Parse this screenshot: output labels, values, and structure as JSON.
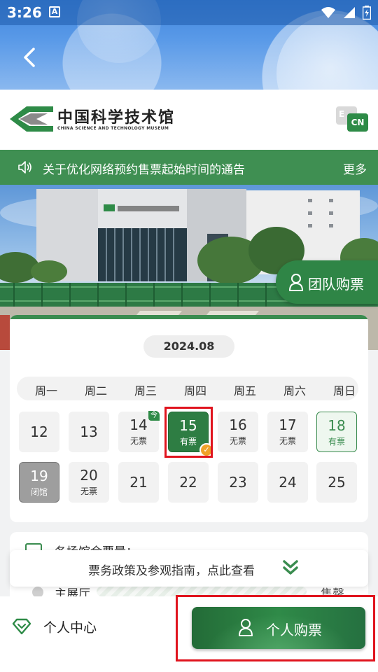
{
  "status_bar": {
    "time": "3:26",
    "notification_glyph": "A"
  },
  "header": {
    "logo_title": "中国科学技术馆",
    "logo_subtitle": "CHINA SCIENCE AND TECHNOLOGY MUSEUM",
    "lang_en": "E",
    "lang_cn": "CN"
  },
  "notice": {
    "text": "关于优化网络预约售票起始时间的通告",
    "more": "更多"
  },
  "team_ticket": {
    "label": "团队购票"
  },
  "calendar": {
    "month": "2024.08",
    "weekdays": [
      "周一",
      "周二",
      "周三",
      "周四",
      "周五",
      "周六",
      "周日"
    ],
    "week1": [
      {
        "day": "12",
        "status": ""
      },
      {
        "day": "13",
        "status": ""
      },
      {
        "day": "14",
        "status": "无票",
        "badge": "今"
      },
      {
        "day": "15",
        "status": "有票",
        "state": "selected"
      },
      {
        "day": "16",
        "status": "无票"
      },
      {
        "day": "17",
        "status": "无票"
      },
      {
        "day": "18",
        "status": "有票",
        "state": "available"
      }
    ],
    "week2": [
      {
        "day": "19",
        "status": "闭馆",
        "state": "closed"
      },
      {
        "day": "20",
        "status": "无票"
      },
      {
        "day": "21",
        "status": ""
      },
      {
        "day": "22",
        "status": ""
      },
      {
        "day": "23",
        "status": ""
      },
      {
        "day": "24",
        "status": ""
      },
      {
        "day": "25",
        "status": ""
      }
    ]
  },
  "remaining": {
    "title": "各场馆余票量：",
    "hall_name": "主展厅",
    "hall_status": "售罄"
  },
  "guide": {
    "text": "票务政策及参观指南，点此查看"
  },
  "bottom": {
    "personal_center": "个人中心",
    "buy_label": "个人购票"
  },
  "colors": {
    "brand_green": "#2e7d43",
    "accent_orange": "#f0a229",
    "highlight_red": "#e0141e"
  },
  "icons": [
    "back-icon",
    "speaker-icon",
    "person-icon",
    "check-icon",
    "chevron-double-down-icon",
    "diamond-icon",
    "wifi-icon",
    "signal-icon",
    "battery-icon"
  ]
}
